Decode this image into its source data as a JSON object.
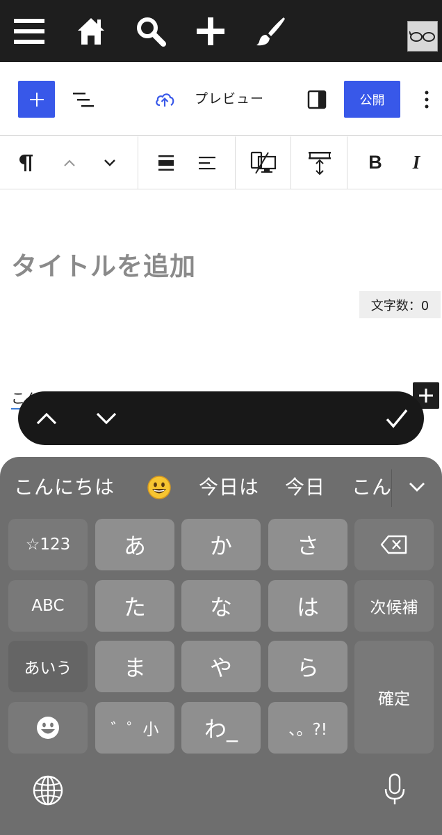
{
  "admin_bar": {
    "icons": [
      "menu-icon",
      "home-icon",
      "search-icon",
      "plus-icon",
      "brush-icon",
      "avatar"
    ]
  },
  "toolbar": {
    "preview_label": "プレビュー",
    "publish_label": "公開"
  },
  "block_toolbar": {
    "icons": [
      "paragraph-icon",
      "move-up-icon",
      "move-down-icon",
      "align-icon",
      "text-align-icon",
      "responsive-icon",
      "spacing-icon",
      "bold-icon",
      "italic-icon"
    ],
    "bold_label": "B",
    "italic_label": "I"
  },
  "content": {
    "title_placeholder": "タイトルを追加",
    "char_count": "文字数：0",
    "paragraph_text": "こんにちは"
  },
  "keyboard": {
    "candidates": [
      "こんにちは",
      "😀",
      "今日は",
      "今日",
      "こん"
    ],
    "rows": [
      [
        "☆123",
        "あ",
        "か",
        "さ"
      ],
      [
        "ABC",
        "た",
        "な",
        "は",
        "次候補"
      ],
      [
        "あいう",
        "ま",
        "や",
        "ら",
        "確定"
      ],
      [
        "ﾞﾟ小",
        "わ_",
        "、。?!"
      ]
    ],
    "key_123": "☆123",
    "key_a": "あ",
    "key_ka": "か",
    "key_sa": "さ",
    "key_abc": "ABC",
    "key_ta": "た",
    "key_na": "な",
    "key_ha": "は",
    "key_next": "次候補",
    "key_aiu": "あいう",
    "key_ma": "ま",
    "key_ya": "や",
    "key_ra": "ら",
    "key_confirm": "確定",
    "key_dakuten": "゛゜小",
    "key_wa": "わ_",
    "key_punct": "、。?!"
  }
}
